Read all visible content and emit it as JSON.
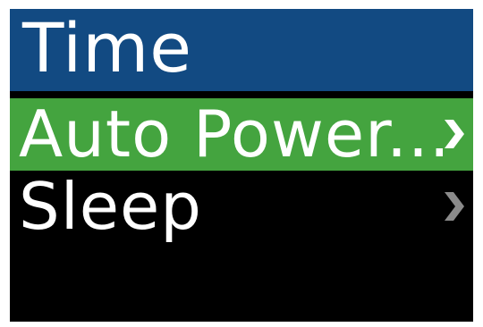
{
  "header": {
    "title": "Time"
  },
  "menu": {
    "items": [
      {
        "label": "Auto Power...",
        "icon": "chevron-right-icon",
        "selected": true
      },
      {
        "label": "Sleep",
        "icon": "chevron-right-icon",
        "selected": false
      }
    ]
  },
  "colors": {
    "header_bg": "#124a82",
    "selected_bg": "#44a43f",
    "screen_bg": "#000000",
    "text": "#ffffff",
    "chevron_active": "#ffffff",
    "chevron_inactive": "#8a8a8a"
  }
}
